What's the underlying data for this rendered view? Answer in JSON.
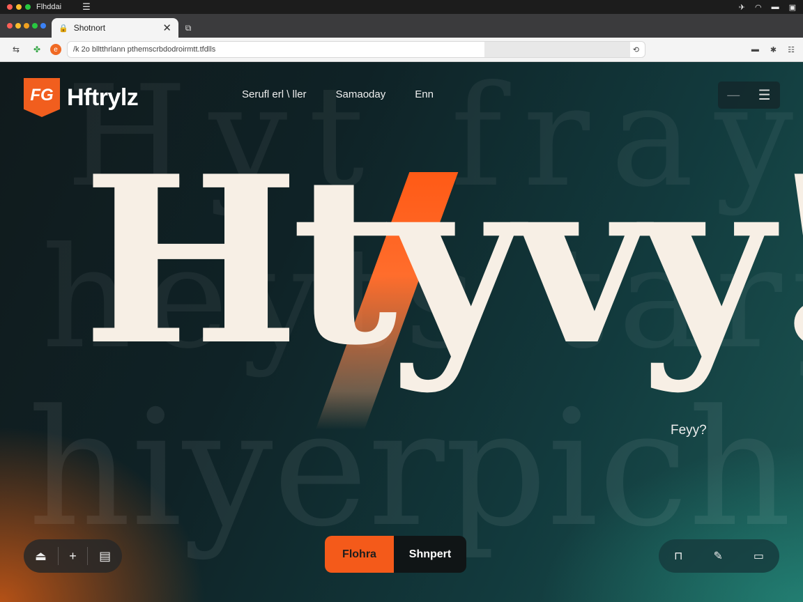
{
  "os": {
    "app_name": "Flhddai",
    "traffic_colors": [
      "#ff5f57",
      "#febc2e",
      "#28c840"
    ]
  },
  "browser": {
    "tab_dot_colors": [
      "#ff5f57",
      "#febc2e",
      "#f0a020",
      "#28c840",
      "#3b82f6"
    ],
    "tab_title": "Shotnort",
    "url": "/k 2o blltthrlann pthemscrbdodroirmtt.tfdlls"
  },
  "site": {
    "logo_mark": "FG",
    "brand": "Hftrylz",
    "nav": [
      "Serufl erl \\ ller",
      "Samaoday",
      "Enn"
    ],
    "hero_text": "Htyvy!",
    "background_words": [
      "Hyt fray",
      "heyts tary",
      "hiyerpich"
    ],
    "tagline": "Feyy?",
    "cta_primary": "Flohra",
    "cta_secondary": "Shnpert",
    "accent_color": "#f45a1a"
  }
}
